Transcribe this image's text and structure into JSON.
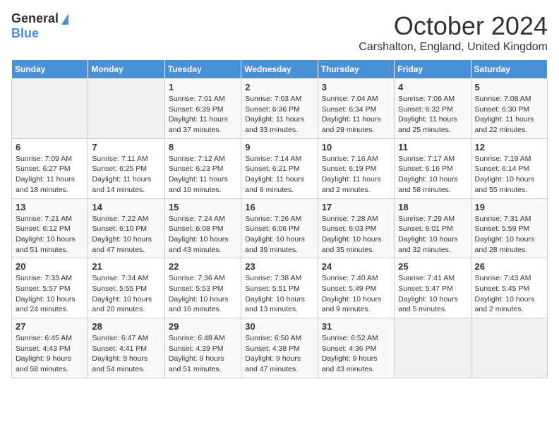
{
  "header": {
    "logo": {
      "general": "General",
      "blue": "Blue"
    },
    "title": "October 2024",
    "subtitle": "Carshalton, England, United Kingdom"
  },
  "calendar": {
    "weekdays": [
      "Sunday",
      "Monday",
      "Tuesday",
      "Wednesday",
      "Thursday",
      "Friday",
      "Saturday"
    ],
    "weeks": [
      [
        {
          "day": "",
          "info": ""
        },
        {
          "day": "",
          "info": ""
        },
        {
          "day": "1",
          "info": "Sunrise: 7:01 AM\nSunset: 6:39 PM\nDaylight: 11 hours and 37 minutes."
        },
        {
          "day": "2",
          "info": "Sunrise: 7:03 AM\nSunset: 6:36 PM\nDaylight: 11 hours and 33 minutes."
        },
        {
          "day": "3",
          "info": "Sunrise: 7:04 AM\nSunset: 6:34 PM\nDaylight: 11 hours and 29 minutes."
        },
        {
          "day": "4",
          "info": "Sunrise: 7:06 AM\nSunset: 6:32 PM\nDaylight: 11 hours and 25 minutes."
        },
        {
          "day": "5",
          "info": "Sunrise: 7:08 AM\nSunset: 6:30 PM\nDaylight: 11 hours and 22 minutes."
        }
      ],
      [
        {
          "day": "6",
          "info": "Sunrise: 7:09 AM\nSunset: 6:27 PM\nDaylight: 11 hours and 18 minutes."
        },
        {
          "day": "7",
          "info": "Sunrise: 7:11 AM\nSunset: 6:25 PM\nDaylight: 11 hours and 14 minutes."
        },
        {
          "day": "8",
          "info": "Sunrise: 7:12 AM\nSunset: 6:23 PM\nDaylight: 11 hours and 10 minutes."
        },
        {
          "day": "9",
          "info": "Sunrise: 7:14 AM\nSunset: 6:21 PM\nDaylight: 11 hours and 6 minutes."
        },
        {
          "day": "10",
          "info": "Sunrise: 7:16 AM\nSunset: 6:19 PM\nDaylight: 11 hours and 2 minutes."
        },
        {
          "day": "11",
          "info": "Sunrise: 7:17 AM\nSunset: 6:16 PM\nDaylight: 10 hours and 58 minutes."
        },
        {
          "day": "12",
          "info": "Sunrise: 7:19 AM\nSunset: 6:14 PM\nDaylight: 10 hours and 55 minutes."
        }
      ],
      [
        {
          "day": "13",
          "info": "Sunrise: 7:21 AM\nSunset: 6:12 PM\nDaylight: 10 hours and 51 minutes."
        },
        {
          "day": "14",
          "info": "Sunrise: 7:22 AM\nSunset: 6:10 PM\nDaylight: 10 hours and 47 minutes."
        },
        {
          "day": "15",
          "info": "Sunrise: 7:24 AM\nSunset: 6:08 PM\nDaylight: 10 hours and 43 minutes."
        },
        {
          "day": "16",
          "info": "Sunrise: 7:26 AM\nSunset: 6:06 PM\nDaylight: 10 hours and 39 minutes."
        },
        {
          "day": "17",
          "info": "Sunrise: 7:28 AM\nSunset: 6:03 PM\nDaylight: 10 hours and 35 minutes."
        },
        {
          "day": "18",
          "info": "Sunrise: 7:29 AM\nSunset: 6:01 PM\nDaylight: 10 hours and 32 minutes."
        },
        {
          "day": "19",
          "info": "Sunrise: 7:31 AM\nSunset: 5:59 PM\nDaylight: 10 hours and 28 minutes."
        }
      ],
      [
        {
          "day": "20",
          "info": "Sunrise: 7:33 AM\nSunset: 5:57 PM\nDaylight: 10 hours and 24 minutes."
        },
        {
          "day": "21",
          "info": "Sunrise: 7:34 AM\nSunset: 5:55 PM\nDaylight: 10 hours and 20 minutes."
        },
        {
          "day": "22",
          "info": "Sunrise: 7:36 AM\nSunset: 5:53 PM\nDaylight: 10 hours and 16 minutes."
        },
        {
          "day": "23",
          "info": "Sunrise: 7:38 AM\nSunset: 5:51 PM\nDaylight: 10 hours and 13 minutes."
        },
        {
          "day": "24",
          "info": "Sunrise: 7:40 AM\nSunset: 5:49 PM\nDaylight: 10 hours and 9 minutes."
        },
        {
          "day": "25",
          "info": "Sunrise: 7:41 AM\nSunset: 5:47 PM\nDaylight: 10 hours and 5 minutes."
        },
        {
          "day": "26",
          "info": "Sunrise: 7:43 AM\nSunset: 5:45 PM\nDaylight: 10 hours and 2 minutes."
        }
      ],
      [
        {
          "day": "27",
          "info": "Sunrise: 6:45 AM\nSunset: 4:43 PM\nDaylight: 9 hours and 58 minutes."
        },
        {
          "day": "28",
          "info": "Sunrise: 6:47 AM\nSunset: 4:41 PM\nDaylight: 9 hours and 54 minutes."
        },
        {
          "day": "29",
          "info": "Sunrise: 6:48 AM\nSunset: 4:39 PM\nDaylight: 9 hours and 51 minutes."
        },
        {
          "day": "30",
          "info": "Sunrise: 6:50 AM\nSunset: 4:38 PM\nDaylight: 9 hours and 47 minutes."
        },
        {
          "day": "31",
          "info": "Sunrise: 6:52 AM\nSunset: 4:36 PM\nDaylight: 9 hours and 43 minutes."
        },
        {
          "day": "",
          "info": ""
        },
        {
          "day": "",
          "info": ""
        }
      ]
    ]
  }
}
